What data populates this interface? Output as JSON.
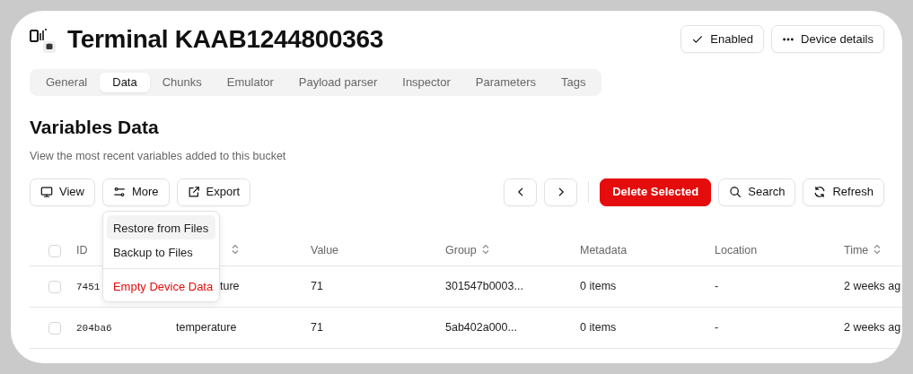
{
  "header": {
    "title": "Terminal KAAB1244800363",
    "buttons": [
      {
        "label": "Enabled",
        "kind": "check"
      },
      {
        "label": "Device details",
        "kind": "dots"
      }
    ]
  },
  "tabs": [
    {
      "label": "General",
      "selected": false
    },
    {
      "label": "Data",
      "selected": true
    },
    {
      "label": "Chunks",
      "selected": false
    },
    {
      "label": "Emulator",
      "selected": false
    },
    {
      "label": "Payload parser",
      "selected": false
    },
    {
      "label": "Inspector",
      "selected": false
    },
    {
      "label": "Parameters",
      "selected": false
    },
    {
      "label": "Tags",
      "selected": false
    }
  ],
  "section": {
    "title": "Variables Data",
    "subtitle": "View the most recent variables added to this bucket"
  },
  "toolbar": {
    "left": [
      {
        "label": "View",
        "kind": "monitor"
      },
      {
        "label": "More",
        "kind": "sliders"
      },
      {
        "label": "Export",
        "kind": "external"
      }
    ],
    "pager": [
      {
        "kind": "prev"
      },
      {
        "kind": "next"
      }
    ],
    "right": [
      {
        "label": "Delete Selected",
        "kind": "danger"
      },
      {
        "label": "Search",
        "kind": "search"
      },
      {
        "label": "Refresh",
        "kind": "refresh"
      }
    ]
  },
  "more_menu": {
    "items": [
      {
        "label": "Restore from Files",
        "kind": "normal",
        "selected": true
      },
      {
        "label": "Backup to Files",
        "kind": "normal",
        "selected": false
      },
      {
        "label": "Empty Device Data",
        "kind": "danger",
        "selected": false
      }
    ]
  },
  "table": {
    "all_checked": false,
    "columns": [
      {
        "label": "ID",
        "sortable": false
      },
      {
        "sortable": true
      },
      {
        "label": "Value",
        "sortable": false
      },
      {
        "label": "Group",
        "sortable": true
      },
      {
        "label": "Metadata",
        "sortable": false
      },
      {
        "label": "Location",
        "sortable": false
      },
      {
        "label": "Time",
        "sortable": true
      }
    ],
    "rows": [
      {
        "checked": false,
        "cells": [
          "7451",
          "ture",
          "71",
          "301547b0003...",
          "0 items",
          "-",
          "2 weeks ag"
        ]
      },
      {
        "checked": false,
        "cells": [
          "204ba6",
          "temperature",
          "71",
          "5ab402a000...",
          "0 items",
          "-",
          "2 weeks ag"
        ]
      }
    ]
  }
}
